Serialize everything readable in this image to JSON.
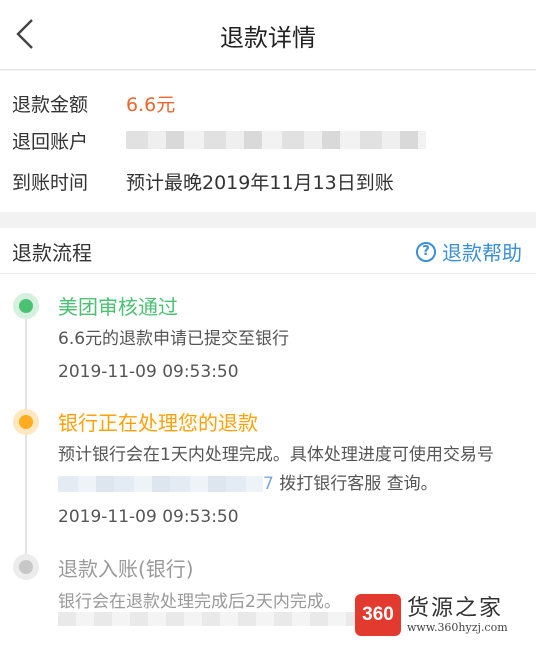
{
  "header": {
    "title": "退款详情",
    "back_icon": "chevron-left-icon"
  },
  "summary": {
    "amount_label": "退款金额",
    "amount_value": "6.6元",
    "account_label": "退回账户",
    "arrival_label": "到账时间",
    "arrival_value": "预计最晚2019年11月13日到账"
  },
  "process": {
    "title": "退款流程",
    "help_icon_glyph": "?",
    "help_label": "退款帮助",
    "steps": [
      {
        "title": "美团审核通过",
        "desc": "6.6元的退款申请已提交至银行",
        "time": "2019-11-09 09:53:50",
        "status": "done",
        "color": "#4cc173"
      },
      {
        "title": "银行正在处理您的退款",
        "desc_part1": "预计银行会在1天内处理完成。具体处理进度可使用交易号",
        "desc_tail": "7",
        "desc_part2": "拨打银行客服  查询。",
        "time": "2019-11-09 09:53:50",
        "status": "processing",
        "color": "#ffa20a"
      },
      {
        "title": "退款入账(银行)",
        "desc": "银行会在退款处理完成后2天内完成。",
        "status": "pending",
        "color": "#9a9a9a"
      }
    ]
  },
  "watermark": {
    "logo_text": "360",
    "name": "货源之家",
    "url": "www.360hyzj.com"
  }
}
